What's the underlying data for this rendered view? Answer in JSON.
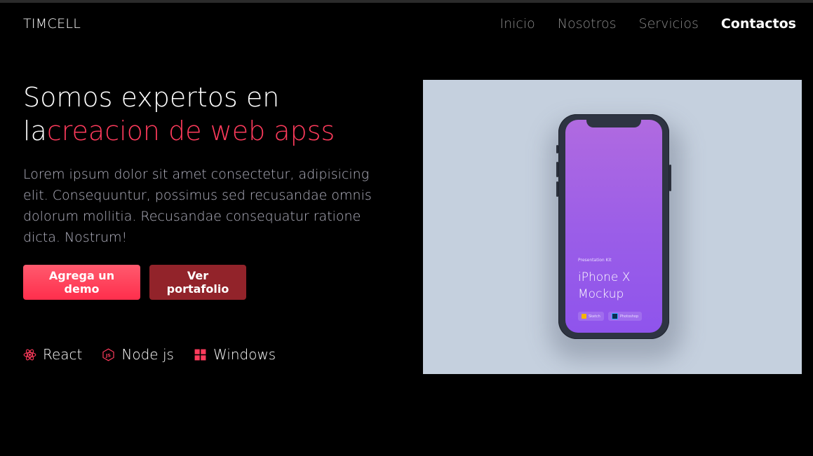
{
  "header": {
    "logo": "TIMCELL",
    "nav": [
      {
        "label": "Inicio"
      },
      {
        "label": "Nosotros"
      },
      {
        "label": "Servicios"
      },
      {
        "label": "Contactos",
        "active": true
      }
    ]
  },
  "hero": {
    "title_line1": "Somos expertos en",
    "title_prefix": "la",
    "title_accent": "creacion de web apss",
    "description": "Lorem ipsum dolor sit amet consectetur, adipisicing elit. Consequuntur, possimus sed recusandae omnis dolorum mollitia. Recusandae consequatur ratione dicta. Nostrum!",
    "buttons": {
      "demo": "Agrega un demo",
      "portfolio": "Ver portafolio"
    },
    "tech": [
      {
        "label": "React",
        "icon": "react-icon"
      },
      {
        "label": "Node js",
        "icon": "nodejs-icon"
      },
      {
        "label": "Windows",
        "icon": "windows-icon"
      }
    ]
  },
  "mockup": {
    "kit_label": "Presentation Kit",
    "kit_title": "iPhone X Mockup",
    "tags": [
      {
        "label": "Sketch",
        "icon": "sketch-icon"
      },
      {
        "label": "Photoshop",
        "icon": "photoshop-icon"
      }
    ]
  },
  "colors": {
    "accent": "#ff3b5c",
    "portfolio_button": "#92232a",
    "mockup_background": "#c5d0de",
    "screen_purple": "#9a5de8"
  }
}
